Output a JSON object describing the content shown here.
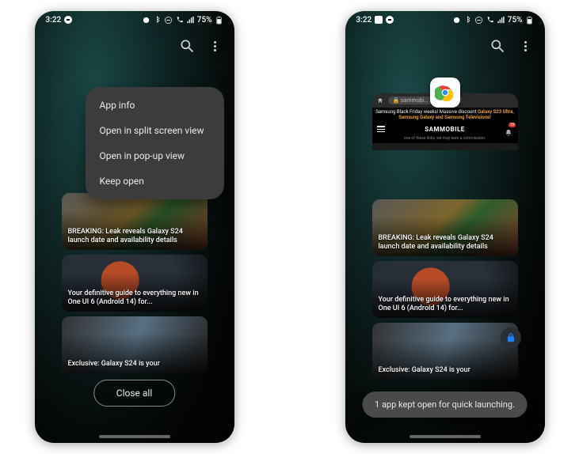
{
  "statusbar": {
    "time": "3:22",
    "battery": "75%"
  },
  "toprow": {
    "search_name": "search-icon",
    "more_name": "more-icon"
  },
  "context_menu": {
    "items": [
      "App info",
      "Open in split screen view",
      "Open in pop-up view",
      "Keep open"
    ]
  },
  "tiles": [
    "BREAKING: Leak reveals Galaxy S24 launch date and availability details",
    "Your definitive guide to everything new in One UI 6 (Android 14) for...",
    "Exclusive: Galaxy S24 is your"
  ],
  "close_all": "Close all",
  "app_card": {
    "url": "sammobi...",
    "banner_prefix": "Samsung Black Friday weeks! Massive discount ",
    "banner_highlight": "Galaxy S23 Ultra, Samsung Galaxy and Samsung Televisions!",
    "logo": "SAMMOBILE",
    "notif_count": "10",
    "disclaimer": "one of these links, we may earn a commission."
  },
  "toast": "1 app kept open for quick launching."
}
